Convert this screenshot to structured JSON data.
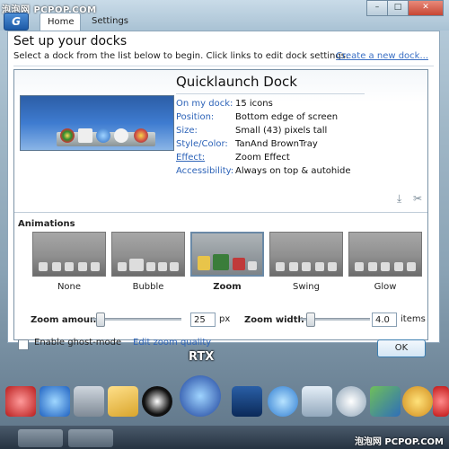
{
  "watermark_top": "泡泡网 PCPOP.COM",
  "watermark_bottom": "泡泡网 PCPOP.COM",
  "app_logo": "G",
  "tabs": [
    {
      "label": "Home"
    },
    {
      "label": "Settings"
    }
  ],
  "window_buttons": {
    "minimize": "–",
    "maximize": "□",
    "close": "✕"
  },
  "heading": "Set up your docks",
  "subheading": "Select a dock from the list below to begin. Click links to edit dock settings.",
  "create_link": "Create a new dock...",
  "dock": {
    "title": "Quicklaunch Dock",
    "info": [
      {
        "label": "On my dock:",
        "value": "15 icons"
      },
      {
        "label": "Position:",
        "value": "Bottom edge of screen"
      },
      {
        "label": "Size:",
        "value": "Small (43) pixels tall"
      },
      {
        "label": "Style/Color:",
        "value": "TanAnd BrownTray"
      },
      {
        "label": "Effect:",
        "value": "Zoom Effect"
      },
      {
        "label": "Accessibility:",
        "value": "Always on top & autohide"
      }
    ]
  },
  "animations": {
    "title": "Animations",
    "items": [
      {
        "label": "None"
      },
      {
        "label": "Bubble"
      },
      {
        "label": "Zoom",
        "selected": true
      },
      {
        "label": "Swing"
      },
      {
        "label": "Glow"
      }
    ]
  },
  "zoom_amount": {
    "label": "Zoom amount",
    "value": "25",
    "unit": "px",
    "level": 0.05
  },
  "zoom_width": {
    "label": "Zoom width",
    "value": "4.0",
    "unit": "items",
    "level": 0.1
  },
  "ghost_mode": {
    "label": "Enable ghost-mode",
    "checked": false
  },
  "edit_zoom_quality": "Edit zoom quality",
  "ok_label": "OK",
  "rtx_label": "RTX",
  "colors": {
    "accent": "#2d63b8",
    "panel_border": "#7b93a7",
    "desktop": "#9fb6c6"
  }
}
